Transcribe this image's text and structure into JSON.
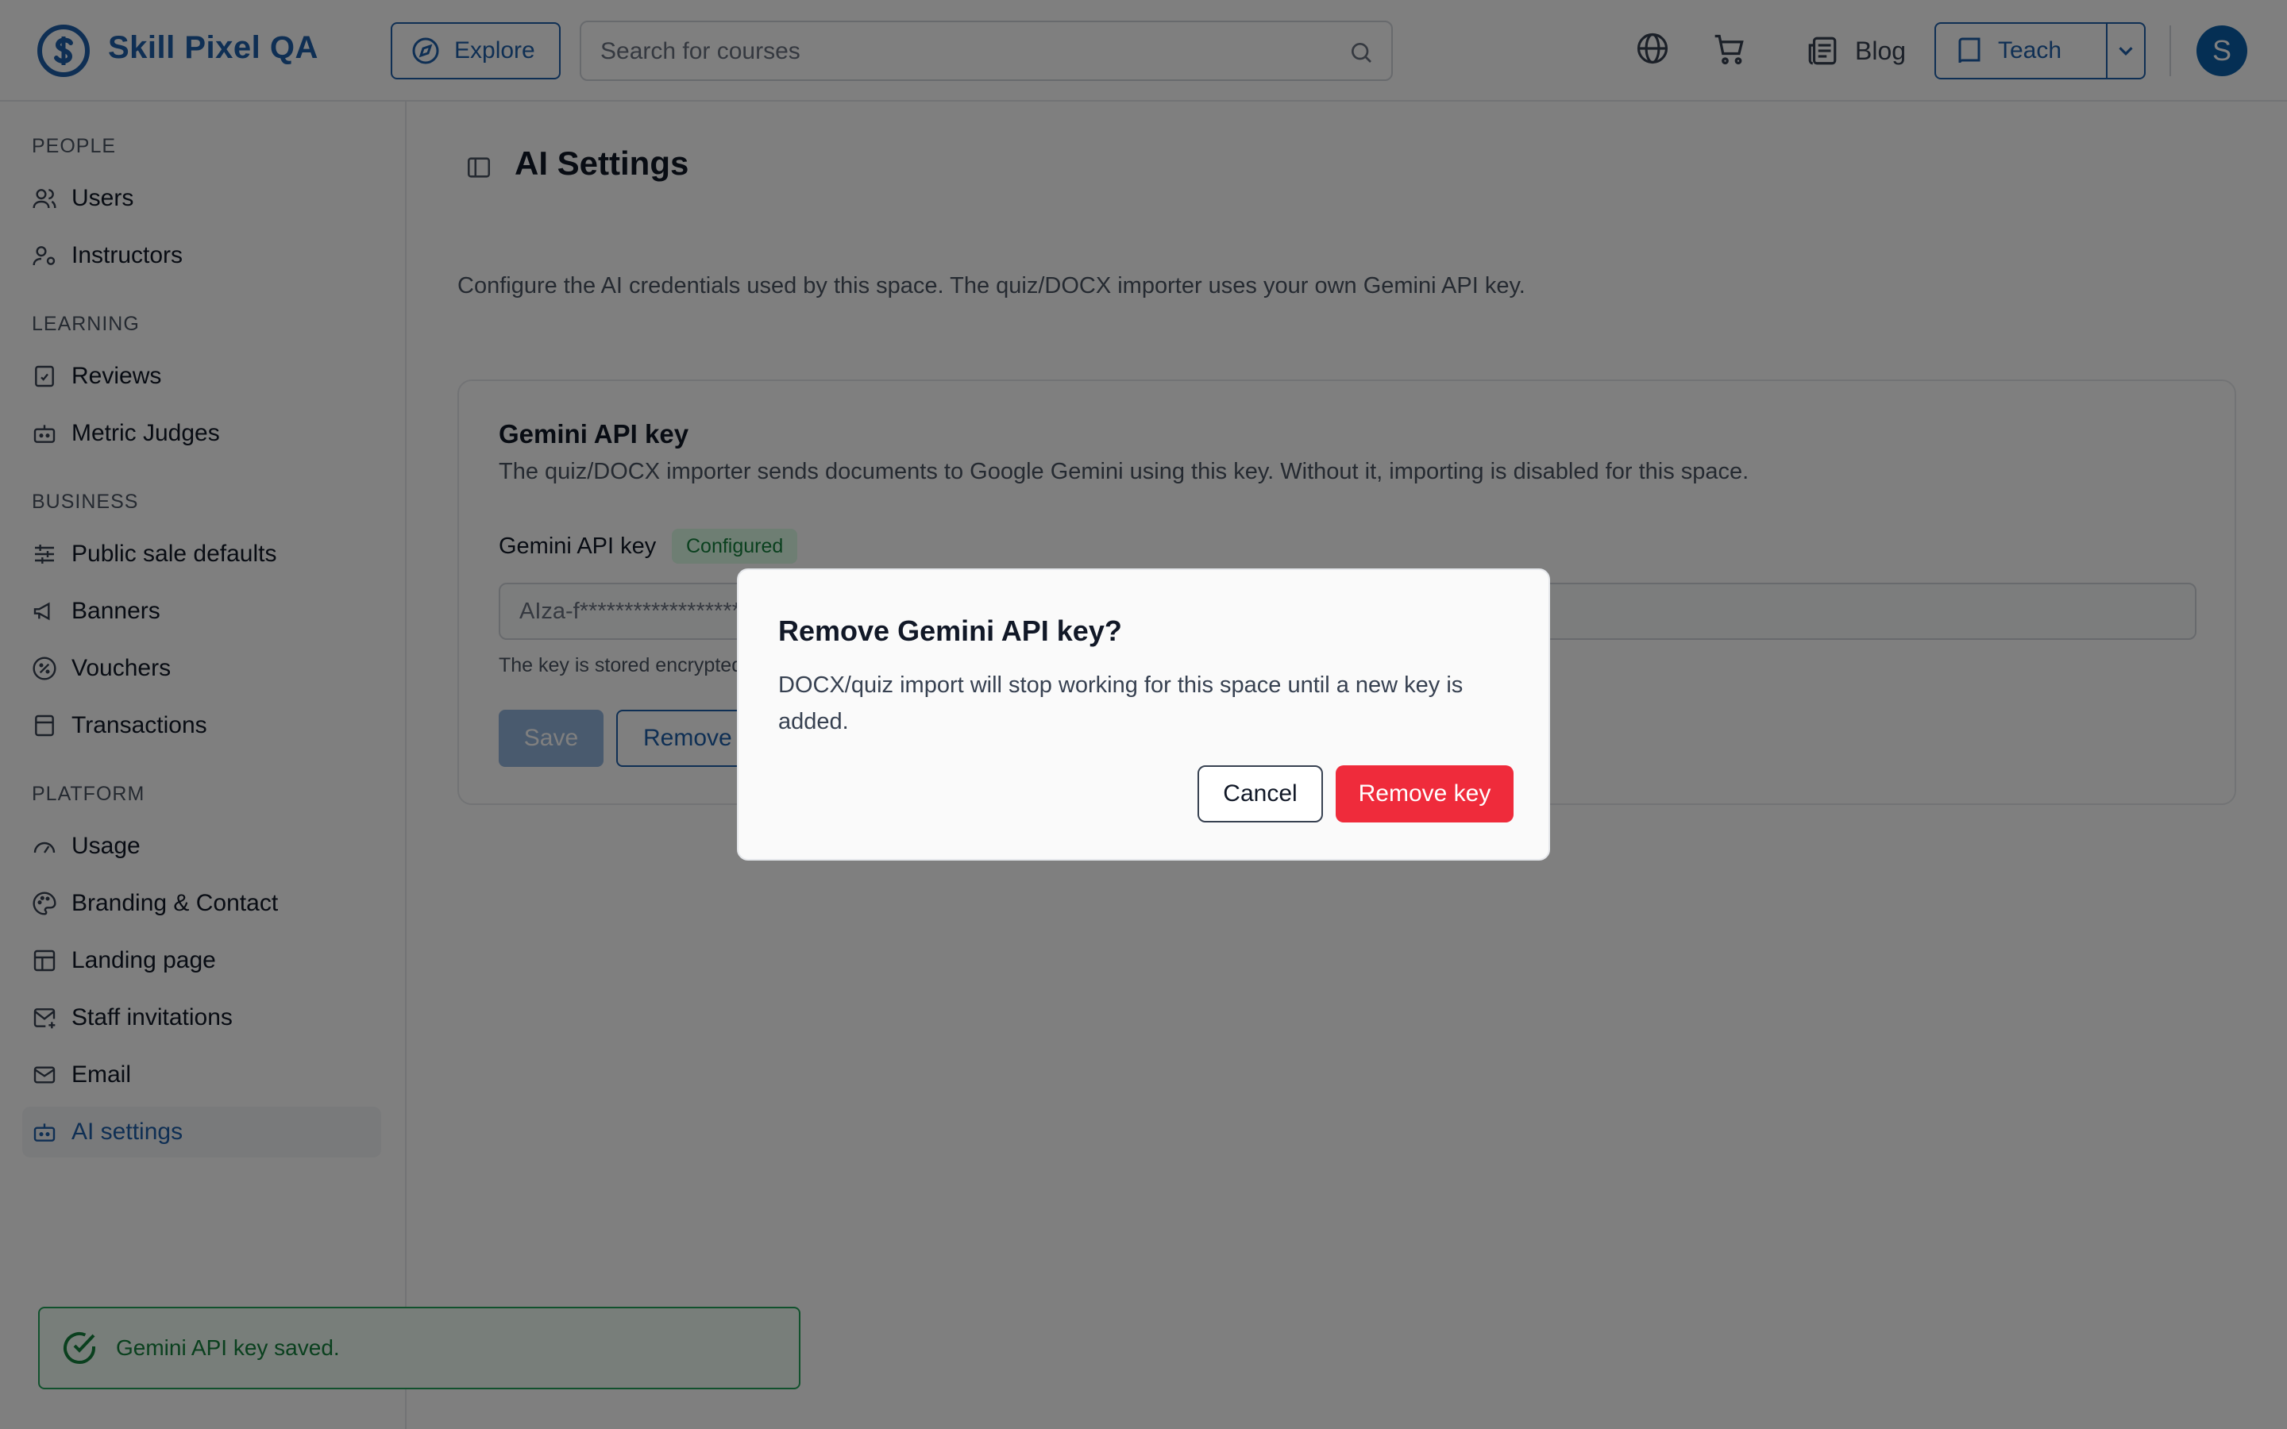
{
  "header": {
    "brand": "Skill Pixel QA",
    "explore_label": "Explore",
    "search_placeholder": "Search for courses",
    "blog_label": "Blog",
    "teach_label": "Teach",
    "avatar_initial": "S"
  },
  "sidebar": {
    "sections": [
      {
        "title": "PEOPLE",
        "items": [
          {
            "label": "Users",
            "icon": "users-icon"
          },
          {
            "label": "Instructors",
            "icon": "user-cog-icon"
          }
        ]
      },
      {
        "title": "LEARNING",
        "items": [
          {
            "label": "Reviews",
            "icon": "clipboard-check-icon"
          },
          {
            "label": "Metric Judges",
            "icon": "bot-icon"
          }
        ]
      },
      {
        "title": "BUSINESS",
        "items": [
          {
            "label": "Public sale defaults",
            "icon": "sliders-icon"
          },
          {
            "label": "Banners",
            "icon": "megaphone-icon"
          },
          {
            "label": "Vouchers",
            "icon": "percent-badge-icon"
          },
          {
            "label": "Transactions",
            "icon": "receipt-icon"
          }
        ]
      },
      {
        "title": "PLATFORM",
        "items": [
          {
            "label": "Usage",
            "icon": "gauge-icon"
          },
          {
            "label": "Branding & Contact",
            "icon": "palette-icon"
          },
          {
            "label": "Landing page",
            "icon": "layout-icon"
          },
          {
            "label": "Staff invitations",
            "icon": "mail-plus-icon"
          },
          {
            "label": "Email",
            "icon": "mail-icon"
          },
          {
            "label": "AI settings",
            "icon": "bot-icon",
            "active": true
          }
        ]
      }
    ]
  },
  "main": {
    "title": "AI Settings",
    "description": "Configure the AI credentials used by this space. The quiz/DOCX importer uses your own Gemini API key.",
    "card": {
      "title": "Gemini API key",
      "description": "The quiz/DOCX importer sends documents to Google Gemini using this key. Without it, importing is disabled for this space.",
      "field_label": "Gemini API key",
      "badge": "Configured",
      "masked_value": "AIza-f**************************************",
      "helper": "The key is stored encrypted",
      "save_label": "Save",
      "remove_label": "Remove key"
    }
  },
  "dialog": {
    "title": "Remove Gemini API key?",
    "body": "DOCX/quiz import will stop working for this space until a new key is added.",
    "cancel_label": "Cancel",
    "confirm_label": "Remove key"
  },
  "toast": {
    "message": "Gemini API key saved."
  },
  "colors": {
    "brand": "#1e5fa8",
    "danger": "#ef2b3b",
    "success": "#15803d"
  }
}
